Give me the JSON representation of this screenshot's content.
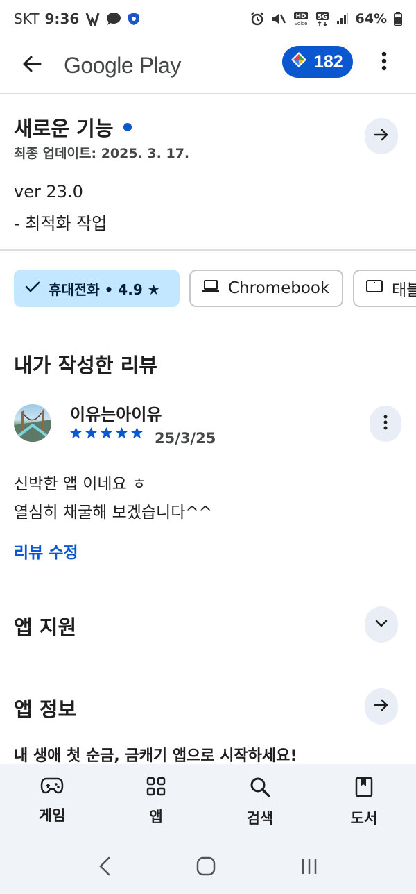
{
  "status_bar": {
    "carrier": "SKT",
    "time": "9:36",
    "battery": "64%",
    "network": "5G",
    "hd_label": "HD",
    "voice_label": "Voice",
    "icons_left": [
      "signal-boost-icon",
      "chat-bubble-icon",
      "shield-icon"
    ],
    "icons_right": [
      "alarm-icon",
      "mute-icon",
      "hd-voice-icon",
      "5g-icon",
      "signal-icon",
      "battery-icon"
    ]
  },
  "app_bar": {
    "title": "Google Play",
    "points": "182",
    "back_icon": "back-arrow-icon",
    "menu_icon": "more-vert-icon"
  },
  "whats_new": {
    "title": "새로운 기능",
    "updated": "최종 업데이트: 2025. 3. 17.",
    "version": "ver 23.0",
    "note": "- 최적화 작업"
  },
  "device_chips": [
    {
      "label": "휴대전화 • 4.9 ★",
      "selected": true,
      "icon": "check-icon"
    },
    {
      "label": "Chromebook",
      "selected": false,
      "icon": "laptop-icon"
    },
    {
      "label": "태블릿",
      "selected": false,
      "icon": "tablet-icon"
    }
  ],
  "my_review": {
    "title": "내가 작성한 리뷰",
    "author": "이유는아이유",
    "rating": 5,
    "date": "25/3/25",
    "text_line1": "신박한 앱 이네요 ㅎ",
    "text_line2": "열심히 채굴해 보겠습니다^^",
    "edit_label": "리뷰 수정"
  },
  "app_support": {
    "title": "앱 지원"
  },
  "about": {
    "title": "앱 정보",
    "description": "내 생애 첫 순금, 금캐기 앱으로 시작하세요!"
  },
  "bottom_nav": [
    {
      "label": "게임",
      "icon": "gamepad-icon"
    },
    {
      "label": "앱",
      "icon": "apps-grid-icon"
    },
    {
      "label": "검색",
      "icon": "search-icon"
    },
    {
      "label": "도서",
      "icon": "book-icon"
    }
  ],
  "colors": {
    "accent": "#0b57d0",
    "chip_selected_bg": "#c2e7ff",
    "nav_bg": "#f0f4f9",
    "round_button_bg": "#e9eef6",
    "star": "#0b57d0"
  }
}
